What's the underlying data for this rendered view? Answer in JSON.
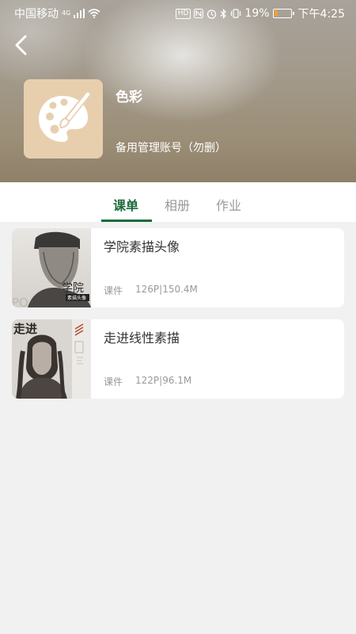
{
  "status_bar": {
    "carrier": "中国移动",
    "network": "4G",
    "battery_percent": "19%",
    "battery_level": 0.19,
    "time": "下午4:25",
    "icons": [
      "hd-icon",
      "nfc-icon",
      "alarm-icon",
      "bluetooth-icon",
      "vibrate-icon",
      "battery-icon"
    ]
  },
  "header": {
    "title": "色彩",
    "subtitle": "备用管理账号（勿删）",
    "logo_icon": "palette-icon",
    "logo_color": "#e7cfae"
  },
  "tabs": [
    {
      "label": "课单",
      "active": true
    },
    {
      "label": "相册",
      "active": false
    },
    {
      "label": "作业",
      "active": false
    }
  ],
  "accent_color": "#1c6a3c",
  "courses": [
    {
      "title": "学院素描头像",
      "type": "课件",
      "stats": "126P|150.4M",
      "cover_text_main": "学院",
      "cover_text_badge": "素描头像",
      "cover_text_watermark": "PO"
    },
    {
      "title": "走进线性素描",
      "type": "课件",
      "stats": "122P|96.1M",
      "cover_text_main": "走进"
    }
  ]
}
